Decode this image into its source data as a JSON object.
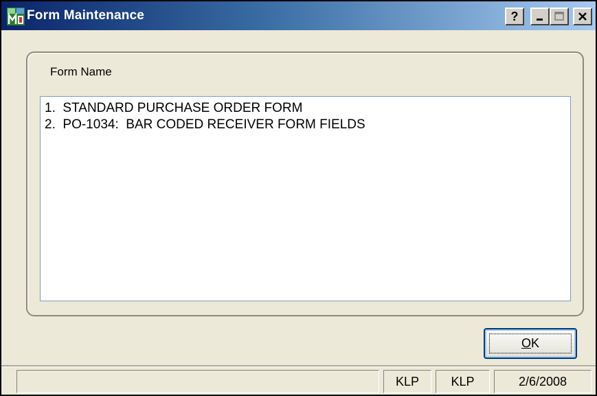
{
  "window": {
    "title": "Form Maintenance",
    "app_icon": "mas90-app-icon",
    "title_buttons": {
      "help": "?",
      "minimize": "minimize-icon",
      "maximize": "maximize-icon",
      "close": "close-icon"
    }
  },
  "group": {
    "label": "Form Name"
  },
  "list": {
    "items": [
      "1.  STANDARD PURCHASE ORDER FORM",
      "2.  PO-1034:  BAR CODED RECEIVER FORM FIELDS"
    ]
  },
  "buttons": {
    "ok_label_mnemonic": "O",
    "ok_label_rest": "K"
  },
  "statusbar": {
    "main": "",
    "user1": "KLP",
    "user2": "KLP",
    "date": "2/6/2008"
  },
  "colors": {
    "titlebar_start": "#0a246a",
    "titlebar_end": "#a6caf0",
    "face": "#ece9d8",
    "button_border": "#003c74"
  }
}
